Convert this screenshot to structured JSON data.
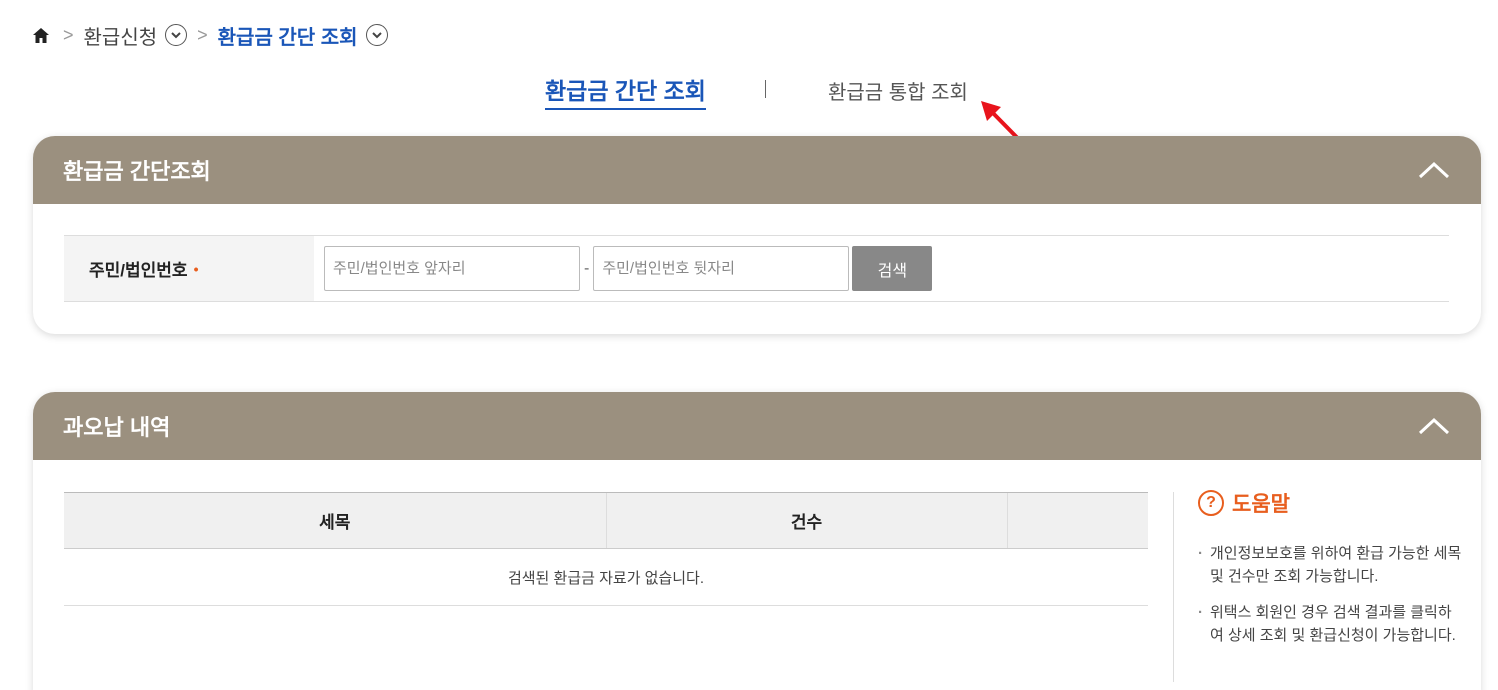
{
  "breadcrumb": {
    "level1": "환급신청",
    "level2": "환급금 간단 조회"
  },
  "tabs": {
    "active": "환급금 간단 조회",
    "other": "환급금 통합 조회"
  },
  "panel1": {
    "title": "환급금 간단조회",
    "label": "주민/법인번호",
    "required_mark": "•",
    "front_placeholder": "주민/법인번호 앞자리",
    "back_placeholder": "주민/법인번호 뒷자리",
    "separator": "-",
    "search_button": "검색"
  },
  "panel2": {
    "title": "과오납 내역",
    "table": {
      "headers": [
        "세목",
        "건수",
        ""
      ],
      "empty_message": "검색된 환급금 자료가 없습니다."
    },
    "help": {
      "title": "도움말",
      "items": [
        "개인정보보호를 위하여 환급 가능한 세목 및 건수만 조회 가능합니다.",
        "위택스 회원인 경우 검색 결과를 클릭하여 상세 조회 및 환급신청이 가능합니다."
      ]
    }
  },
  "colors": {
    "header_bg": "#9b907f",
    "accent_blue": "#1a56b8",
    "help_orange": "#e85e1e",
    "annotation_red": "#e8141c"
  }
}
